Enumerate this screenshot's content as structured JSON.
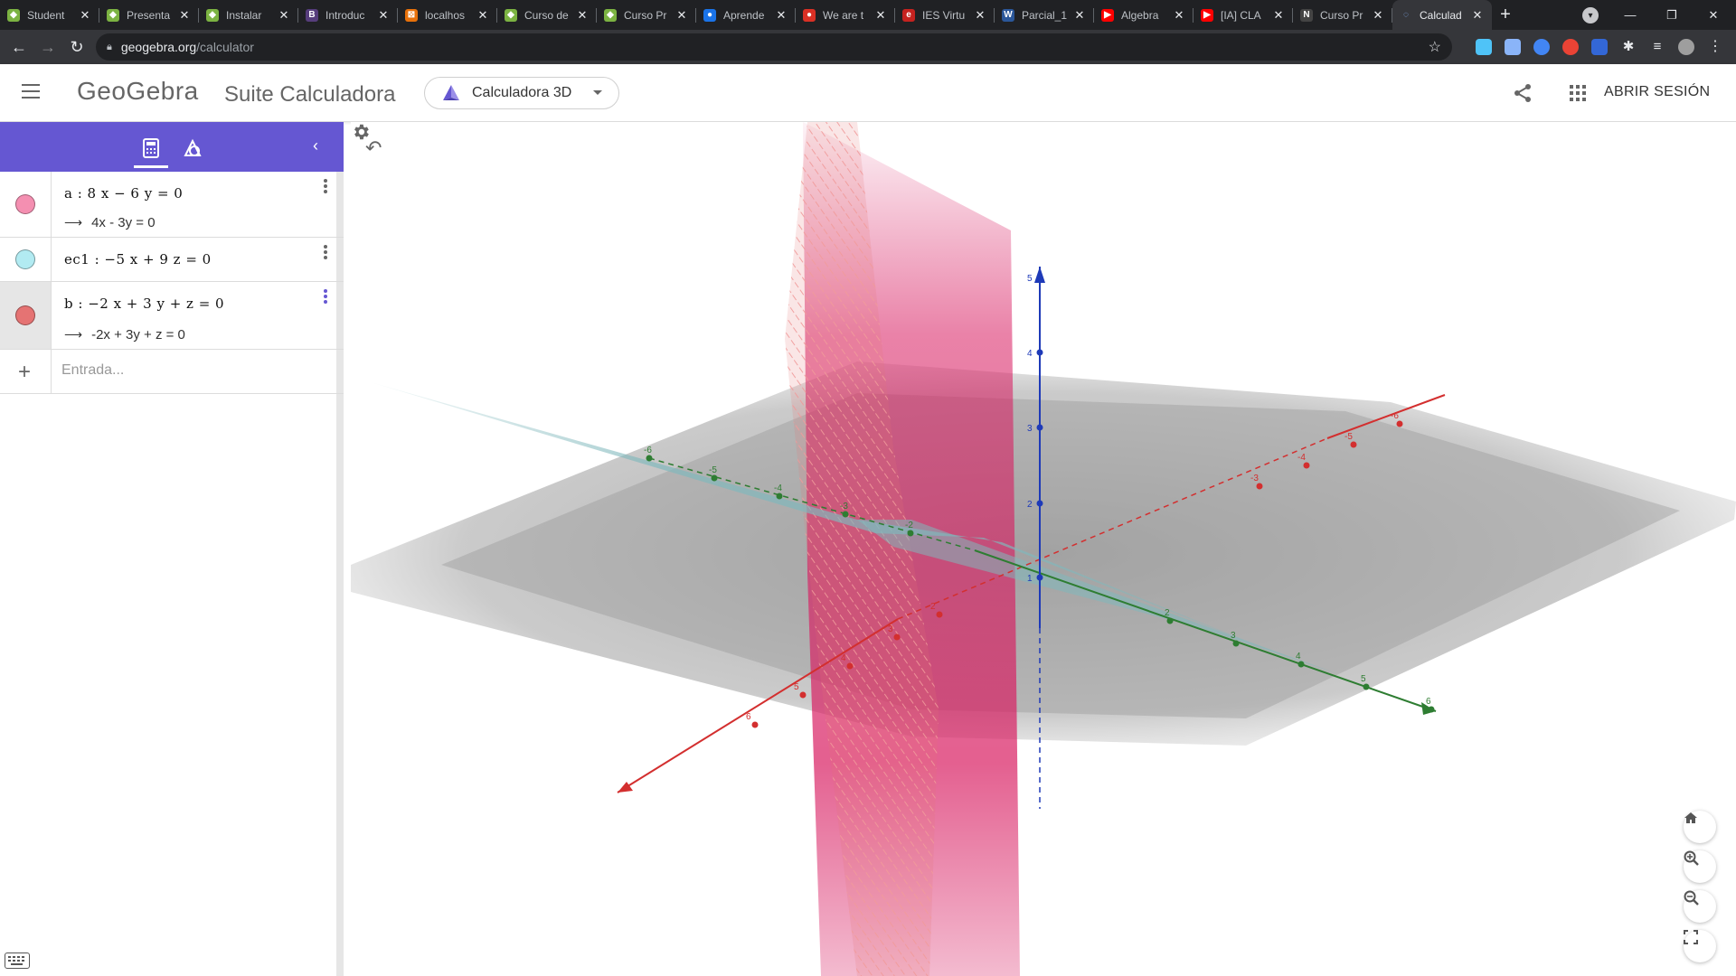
{
  "browser": {
    "tabs": [
      {
        "title": "Student",
        "color": "#7cb342",
        "glyph": "◆"
      },
      {
        "title": "Presenta",
        "color": "#7cb342",
        "glyph": "◆"
      },
      {
        "title": "Instalar",
        "color": "#7cb342",
        "glyph": "◆"
      },
      {
        "title": "Introduc",
        "color": "#563d7c",
        "glyph": "B"
      },
      {
        "title": "localhos",
        "color": "#e8710a",
        "glyph": "⊠"
      },
      {
        "title": "Curso de",
        "color": "#7cb342",
        "glyph": "◆"
      },
      {
        "title": "Curso Pr",
        "color": "#7cb342",
        "glyph": "◆"
      },
      {
        "title": "Aprende",
        "color": "#1a73e8",
        "glyph": "●"
      },
      {
        "title": "We are t",
        "color": "#d93025",
        "glyph": "●"
      },
      {
        "title": "IES Virtu",
        "color": "#c5221f",
        "glyph": "e"
      },
      {
        "title": "Parcial_1",
        "color": "#2b579a",
        "glyph": "W"
      },
      {
        "title": "Algebra",
        "color": "#ff0000",
        "glyph": "▶"
      },
      {
        "title": "[IA] CLA",
        "color": "#ff0000",
        "glyph": "▶"
      },
      {
        "title": "Curso Pr",
        "color": "#444444",
        "glyph": "N"
      },
      {
        "title": "Calculad",
        "color": "#35363a",
        "glyph": "◌",
        "active": true
      }
    ],
    "url_host": "geogebra.org",
    "url_path": "/calculator"
  },
  "header": {
    "logo": "GeoGebra",
    "suite": "Suite Calculadora",
    "app_selector": "Calculadora 3D",
    "login": "ABRIR SESIÓN"
  },
  "algebra": {
    "rows": [
      {
        "definition": "a : 8 x − 6 y = 0",
        "output": "4x - 3y = 0",
        "color": "#f48fb1"
      },
      {
        "definition": "ec1 : −5 x + 9 z = 0",
        "output": "",
        "color": "#b2ebf2"
      },
      {
        "definition": "b : −2 x + 3 y + z = 0",
        "output": "-2x + 3y + z = 0",
        "color": "#e57373"
      }
    ],
    "input_placeholder": "Entrada..."
  },
  "graphics": {
    "axes": {
      "x_color": "#d32f2f",
      "y_color": "#2e7d32",
      "z_color": "#1e3ab8",
      "x_ticks": [
        "-6",
        "-5",
        "-4",
        "-3",
        "2",
        "3",
        "4",
        "5",
        "6"
      ],
      "y_ticks": [
        "-6",
        "-5",
        "-4",
        "-3",
        "-2",
        "2",
        "3",
        "4",
        "5",
        "6"
      ],
      "z_ticks": [
        "1",
        "2",
        "3",
        "4",
        "5"
      ]
    },
    "plane_colors": {
      "a": "#d81b60",
      "ec1": "#80b8bc",
      "b": "#e57373",
      "xy_floor": "#9e9e9e"
    }
  }
}
